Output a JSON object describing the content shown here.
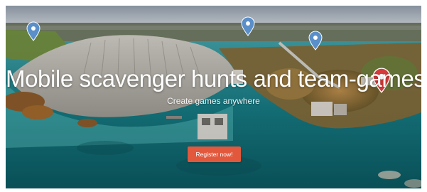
{
  "hero": {
    "headline": "Mobile scavenger hunts and team-games",
    "subheadline": "Create games anywhere",
    "cta_label": "Register now!"
  },
  "markers": [
    {
      "icon": "map-pin-icon",
      "color": "#5a8fc9"
    },
    {
      "icon": "map-pin-icon",
      "color": "#5a8fc9"
    },
    {
      "icon": "map-pin-icon",
      "color": "#5a8fc9"
    },
    {
      "icon": "map-pin-icon",
      "color": "#d63b3b"
    }
  ],
  "colors": {
    "cta": "#e2583d",
    "text": "#ffffff",
    "water": "#0d6b72",
    "pin_blue": "#5a8fc9",
    "pin_red": "#d63b3b"
  }
}
